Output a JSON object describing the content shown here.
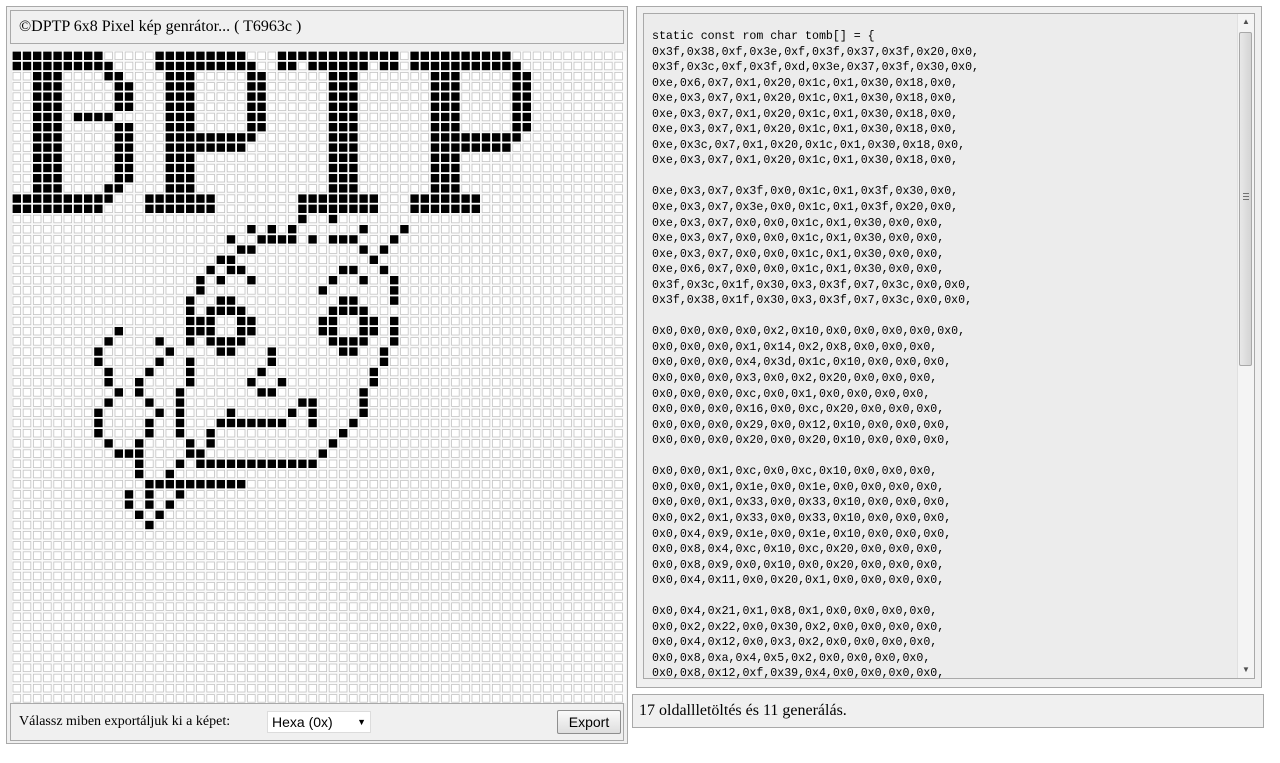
{
  "title": "©DPTP 6x8 Pixel kép genrátor... ( T6963c )",
  "export": {
    "label": "Válassz miben exportáljuk ki a képet:",
    "selected": "Hexa (0x)",
    "button": "Export"
  },
  "status": "17 oldallletöltés és 11 generálás.",
  "code": {
    "header": "static const rom char tomb[] = {",
    "blocks": [
      [
        "0x3f,0x38,0xf,0x3e,0xf,0x3f,0x37,0x3f,0x20,0x0,",
        "0x3f,0x3c,0xf,0x3f,0xd,0x3e,0x37,0x3f,0x30,0x0,",
        "0xe,0x6,0x7,0x1,0x20,0x1c,0x1,0x30,0x18,0x0,",
        "0xe,0x3,0x7,0x1,0x20,0x1c,0x1,0x30,0x18,0x0,",
        "0xe,0x3,0x7,0x1,0x20,0x1c,0x1,0x30,0x18,0x0,",
        "0xe,0x3,0x7,0x1,0x20,0x1c,0x1,0x30,0x18,0x0,",
        "0xe,0x3c,0x7,0x1,0x20,0x1c,0x1,0x30,0x18,0x0,",
        "0xe,0x3,0x7,0x1,0x20,0x1c,0x1,0x30,0x18,0x0,"
      ],
      [
        "0xe,0x3,0x7,0x3f,0x0,0x1c,0x1,0x3f,0x30,0x0,",
        "0xe,0x3,0x7,0x3e,0x0,0x1c,0x1,0x3f,0x20,0x0,",
        "0xe,0x3,0x7,0x0,0x0,0x1c,0x1,0x30,0x0,0x0,",
        "0xe,0x3,0x7,0x0,0x0,0x1c,0x1,0x30,0x0,0x0,",
        "0xe,0x3,0x7,0x0,0x0,0x1c,0x1,0x30,0x0,0x0,",
        "0xe,0x6,0x7,0x0,0x0,0x1c,0x1,0x30,0x0,0x0,",
        "0x3f,0x3c,0x1f,0x30,0x3,0x3f,0x7,0x3c,0x0,0x0,",
        "0x3f,0x38,0x1f,0x30,0x3,0x3f,0x7,0x3c,0x0,0x0,"
      ],
      [
        "0x0,0x0,0x0,0x0,0x2,0x10,0x0,0x0,0x0,0x0,0x0,",
        "0x0,0x0,0x0,0x1,0x14,0x2,0x8,0x0,0x0,0x0,",
        "0x0,0x0,0x0,0x4,0x3d,0x1c,0x10,0x0,0x0,0x0,",
        "0x0,0x0,0x0,0x3,0x0,0x2,0x20,0x0,0x0,0x0,",
        "0x0,0x0,0x0,0xc,0x0,0x1,0x0,0x0,0x0,0x0,",
        "0x0,0x0,0x0,0x16,0x0,0xc,0x20,0x0,0x0,0x0,",
        "0x0,0x0,0x0,0x29,0x0,0x12,0x10,0x0,0x0,0x0,",
        "0x0,0x0,0x0,0x20,0x0,0x20,0x10,0x0,0x0,0x0,"
      ],
      [
        "0x0,0x0,0x1,0xc,0x0,0xc,0x10,0x0,0x0,0x0,",
        "0x0,0x0,0x1,0x1e,0x0,0x1e,0x0,0x0,0x0,0x0,",
        "0x0,0x0,0x1,0x33,0x0,0x33,0x10,0x0,0x0,0x0,",
        "0x0,0x2,0x1,0x33,0x0,0x33,0x10,0x0,0x0,0x0,",
        "0x0,0x4,0x9,0x1e,0x0,0x1e,0x10,0x0,0x0,0x0,",
        "0x0,0x8,0x4,0xc,0x10,0xc,0x20,0x0,0x0,0x0,",
        "0x0,0x8,0x9,0x0,0x10,0x0,0x20,0x0,0x0,0x0,",
        "0x0,0x4,0x11,0x0,0x20,0x1,0x0,0x0,0x0,0x0,"
      ],
      [
        "0x0,0x4,0x21,0x1,0x8,0x1,0x0,0x0,0x0,0x0,",
        "0x0,0x2,0x22,0x0,0x30,0x2,0x0,0x0,0x0,0x0,",
        "0x0,0x4,0x12,0x0,0x3,0x2,0x0,0x0,0x0,0x0,",
        "0x0,0x8,0xa,0x4,0x5,0x2,0x0,0x0,0x0,0x0,",
        "0x0,0x8,0x12,0xf,0x39,0x4,0x0,0x0,0x0,0x0,"
      ]
    ]
  },
  "pixel_editor": {
    "grid_columns": 60,
    "grid_rows": 64,
    "cell_on_color": "#000000",
    "cell_off_color": "#ffffff",
    "cell_off_border": "#c4c4c4",
    "cells_per_byte": 6,
    "bytes_per_row": 10,
    "image_rows": [
      [
        "0x3f",
        "0x38",
        "0xf",
        "0x3e",
        "0xf",
        "0x3f",
        "0x37",
        "0x3f",
        "0x20",
        "0x0"
      ],
      [
        "0x3f",
        "0x3c",
        "0xf",
        "0x3f",
        "0xd",
        "0x3e",
        "0x37",
        "0x3f",
        "0x30",
        "0x0"
      ],
      [
        "0xe",
        "0x6",
        "0x7",
        "0x1",
        "0x20",
        "0x1c",
        "0x1",
        "0x30",
        "0x18",
        "0x0"
      ],
      [
        "0xe",
        "0x3",
        "0x7",
        "0x1",
        "0x20",
        "0x1c",
        "0x1",
        "0x30",
        "0x18",
        "0x0"
      ],
      [
        "0xe",
        "0x3",
        "0x7",
        "0x1",
        "0x20",
        "0x1c",
        "0x1",
        "0x30",
        "0x18",
        "0x0"
      ],
      [
        "0xe",
        "0x3",
        "0x7",
        "0x1",
        "0x20",
        "0x1c",
        "0x1",
        "0x30",
        "0x18",
        "0x0"
      ],
      [
        "0xe",
        "0x3c",
        "0x7",
        "0x1",
        "0x20",
        "0x1c",
        "0x1",
        "0x30",
        "0x18",
        "0x0"
      ],
      [
        "0xe",
        "0x3",
        "0x7",
        "0x1",
        "0x20",
        "0x1c",
        "0x1",
        "0x30",
        "0x18",
        "0x0"
      ],
      [
        "0xe",
        "0x3",
        "0x7",
        "0x3f",
        "0x0",
        "0x1c",
        "0x1",
        "0x3f",
        "0x30",
        "0x0"
      ],
      [
        "0xe",
        "0x3",
        "0x7",
        "0x3e",
        "0x0",
        "0x1c",
        "0x1",
        "0x3f",
        "0x20",
        "0x0"
      ],
      [
        "0xe",
        "0x3",
        "0x7",
        "0x0",
        "0x0",
        "0x1c",
        "0x1",
        "0x30",
        "0x0",
        "0x0"
      ],
      [
        "0xe",
        "0x3",
        "0x7",
        "0x0",
        "0x0",
        "0x1c",
        "0x1",
        "0x30",
        "0x0",
        "0x0"
      ],
      [
        "0xe",
        "0x3",
        "0x7",
        "0x0",
        "0x0",
        "0x1c",
        "0x1",
        "0x30",
        "0x0",
        "0x0"
      ],
      [
        "0xe",
        "0x6",
        "0x7",
        "0x0",
        "0x0",
        "0x1c",
        "0x1",
        "0x30",
        "0x0",
        "0x0"
      ],
      [
        "0x3f",
        "0x3c",
        "0x1f",
        "0x30",
        "0x3",
        "0x3f",
        "0x7",
        "0x3c",
        "0x0",
        "0x0"
      ],
      [
        "0x3f",
        "0x38",
        "0x1f",
        "0x30",
        "0x3",
        "0x3f",
        "0x7",
        "0x3c",
        "0x0",
        "0x0"
      ],
      [
        "0x0",
        "0x0",
        "0x0",
        "0x0",
        "0x2",
        "0x10",
        "0x0",
        "0x0",
        "0x0",
        "0x0"
      ],
      [
        "0x0",
        "0x0",
        "0x0",
        "0x1",
        "0x14",
        "0x2",
        "0x8",
        "0x0",
        "0x0",
        "0x0"
      ],
      [
        "0x0",
        "0x0",
        "0x0",
        "0x4",
        "0x3d",
        "0x1c",
        "0x10",
        "0x0",
        "0x0",
        "0x0"
      ],
      [
        "0x0",
        "0x0",
        "0x0",
        "0x3",
        "0x0",
        "0x2",
        "0x20",
        "0x0",
        "0x0",
        "0x0"
      ],
      [
        "0x0",
        "0x0",
        "0x0",
        "0xc",
        "0x0",
        "0x1",
        "0x0",
        "0x0",
        "0x0",
        "0x0"
      ],
      [
        "0x0",
        "0x0",
        "0x0",
        "0x16",
        "0x0",
        "0xc",
        "0x20",
        "0x0",
        "0x0",
        "0x0"
      ],
      [
        "0x0",
        "0x0",
        "0x0",
        "0x29",
        "0x0",
        "0x12",
        "0x10",
        "0x0",
        "0x0",
        "0x0"
      ],
      [
        "0x0",
        "0x0",
        "0x0",
        "0x20",
        "0x0",
        "0x20",
        "0x10",
        "0x0",
        "0x0",
        "0x0"
      ],
      [
        "0x0",
        "0x0",
        "0x1",
        "0xc",
        "0x0",
        "0xc",
        "0x10",
        "0x0",
        "0x0",
        "0x0"
      ],
      [
        "0x0",
        "0x0",
        "0x1",
        "0x1e",
        "0x0",
        "0x1e",
        "0x0",
        "0x0",
        "0x0",
        "0x0"
      ],
      [
        "0x0",
        "0x0",
        "0x1",
        "0x33",
        "0x0",
        "0x33",
        "0x10",
        "0x0",
        "0x0",
        "0x0"
      ],
      [
        "0x0",
        "0x2",
        "0x1",
        "0x33",
        "0x0",
        "0x33",
        "0x10",
        "0x0",
        "0x0",
        "0x0"
      ],
      [
        "0x0",
        "0x4",
        "0x9",
        "0x1e",
        "0x0",
        "0x1e",
        "0x10",
        "0x0",
        "0x0",
        "0x0"
      ],
      [
        "0x0",
        "0x8",
        "0x4",
        "0xc",
        "0x10",
        "0xc",
        "0x20",
        "0x0",
        "0x0",
        "0x0"
      ],
      [
        "0x0",
        "0x8",
        "0x9",
        "0x0",
        "0x10",
        "0x0",
        "0x20",
        "0x0",
        "0x0",
        "0x0"
      ],
      [
        "0x0",
        "0x4",
        "0x11",
        "0x0",
        "0x20",
        "0x1",
        "0x0",
        "0x0",
        "0x0",
        "0x0"
      ],
      [
        "0x0",
        "0x4",
        "0x21",
        "0x1",
        "0x8",
        "0x1",
        "0x0",
        "0x0",
        "0x0",
        "0x0"
      ],
      [
        "0x0",
        "0x2",
        "0x22",
        "0x0",
        "0x30",
        "0x2",
        "0x0",
        "0x0",
        "0x0",
        "0x0"
      ],
      [
        "0x0",
        "0x4",
        "0x12",
        "0x0",
        "0x3",
        "0x2",
        "0x0",
        "0x0",
        "0x0",
        "0x0"
      ],
      [
        "0x0",
        "0x8",
        "0xa",
        "0x4",
        "0x5",
        "0x2",
        "0x0",
        "0x0",
        "0x0",
        "0x0"
      ],
      [
        "0x0",
        "0x8",
        "0x12",
        "0xf",
        "0x39",
        "0x4",
        "0x0",
        "0x0",
        "0x0",
        "0x0"
      ],
      [
        "0x0",
        "0x8",
        "0x12",
        "0x10",
        "0x0",
        "0x8",
        "0x0",
        "0x0",
        "0x0",
        "0x0"
      ],
      [
        "0x0",
        "0x4",
        "0x21",
        "0x10",
        "0x0",
        "0x10",
        "0x0",
        "0x0",
        "0x0",
        "0x0"
      ],
      [
        "0x0",
        "0x3",
        "0x21",
        "0x20",
        "0x0",
        "0x20",
        "0x0",
        "0x0",
        "0x0",
        "0x0"
      ],
      [
        "0x0",
        "0x0",
        "0x22",
        "0x3f",
        "0x3f",
        "0x0",
        "0x0",
        "0x0",
        "0x0",
        "0x0"
      ],
      [
        "0x0",
        "0x0",
        "0x24",
        "0x0",
        "0x0",
        "0x0",
        "0x0",
        "0x0",
        "0x0",
        "0x0"
      ],
      [
        "0x0",
        "0x0",
        "0x1f",
        "0x3e",
        "0x0",
        "0x0",
        "0x0",
        "0x0",
        "0x0",
        "0x0"
      ],
      [
        "0x0",
        "0x1",
        "0x12",
        "0x0",
        "0x0",
        "0x0",
        "0x0",
        "0x0",
        "0x0",
        "0x0"
      ],
      [
        "0x0",
        "0x1",
        "0x14",
        "0x0",
        "0x0",
        "0x0",
        "0x0",
        "0x0",
        "0x0",
        "0x0"
      ],
      [
        "0x0",
        "0x0",
        "0x28",
        "0x0",
        "0x0",
        "0x0",
        "0x0",
        "0x0",
        "0x0",
        "0x0"
      ],
      [
        "0x0",
        "0x0",
        "0x10",
        "0x0",
        "0x0",
        "0x0",
        "0x0",
        "0x0",
        "0x0",
        "0x0"
      ]
    ]
  }
}
